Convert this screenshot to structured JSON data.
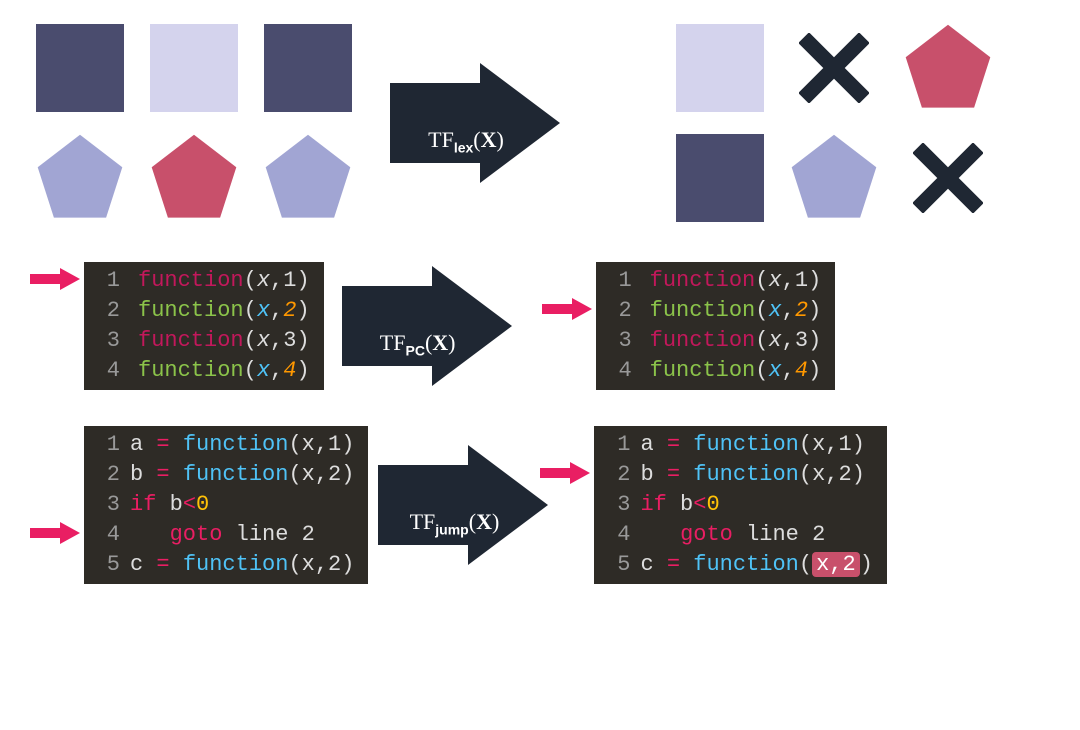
{
  "arrows": {
    "lex": {
      "prefix": "TF",
      "sub": "lex",
      "arg": "X"
    },
    "pc": {
      "prefix": "TF",
      "sub": "PC",
      "arg": "X"
    },
    "jump": {
      "prefix": "TF",
      "sub": "jump",
      "arg": "X"
    }
  },
  "shapes": {
    "left": [
      {
        "shape": "square",
        "color": "dark"
      },
      {
        "shape": "square",
        "color": "light"
      },
      {
        "shape": "square",
        "color": "dark"
      },
      {
        "shape": "pentagon",
        "color": "mid"
      },
      {
        "shape": "pentagon",
        "color": "red"
      },
      {
        "shape": "pentagon",
        "color": "mid"
      }
    ],
    "right": [
      {
        "shape": "square",
        "color": "light"
      },
      {
        "shape": "x",
        "color": "black"
      },
      {
        "shape": "pentagon",
        "color": "red"
      },
      {
        "shape": "square",
        "color": "dark"
      },
      {
        "shape": "pentagon",
        "color": "mid"
      },
      {
        "shape": "x",
        "color": "black"
      }
    ]
  },
  "code_pc": {
    "left_pointer_line": 1,
    "right_pointer_line": 2,
    "lines": [
      {
        "n": "1",
        "style": "pink",
        "fn": "function",
        "x": "x",
        "num": "1",
        "num_style": "w"
      },
      {
        "n": "2",
        "style": "green",
        "fn": "function",
        "x": "x",
        "num": "2",
        "num_style": "o"
      },
      {
        "n": "3",
        "style": "pink",
        "fn": "function",
        "x": "x",
        "num": "3",
        "num_style": "w"
      },
      {
        "n": "4",
        "style": "green",
        "fn": "function",
        "x": "x",
        "num": "4",
        "num_style": "o"
      }
    ]
  },
  "code_jump": {
    "left_pointer_line": 4,
    "right_pointer_line": 2,
    "left_lines": [
      {
        "n": "1",
        "raw": "a = function(x,1)",
        "type": "assign",
        "v": "a",
        "num": "1"
      },
      {
        "n": "2",
        "raw": "b = function(x,2)",
        "type": "assign",
        "v": "b",
        "num": "2"
      },
      {
        "n": "3",
        "raw": "if b<0",
        "type": "if"
      },
      {
        "n": "4",
        "raw": "   goto line 2",
        "type": "goto",
        "target": "2"
      },
      {
        "n": "5",
        "raw": "c = function(x,2)",
        "type": "assign",
        "v": "c",
        "num": "2"
      }
    ],
    "right_lines": [
      {
        "n": "1",
        "raw": "a = function(x,1)",
        "type": "assign",
        "v": "a",
        "num": "1"
      },
      {
        "n": "2",
        "raw": "b = function(x,2)",
        "type": "assign",
        "v": "b",
        "num": "2"
      },
      {
        "n": "3",
        "raw": "if b<0",
        "type": "if"
      },
      {
        "n": "4",
        "raw": "   goto line 2",
        "type": "goto",
        "target": "2"
      },
      {
        "n": "5",
        "raw": "c = function(x,2)",
        "type": "assign_hilite",
        "v": "c",
        "num": "2",
        "hilite": "x,2"
      }
    ]
  },
  "colors": {
    "dark": "#4a4c6e",
    "light": "#d4d3ed",
    "mid": "#a1a5d3",
    "red": "#c8506b",
    "black": "#1f2733",
    "pointer": "#e91e63"
  }
}
